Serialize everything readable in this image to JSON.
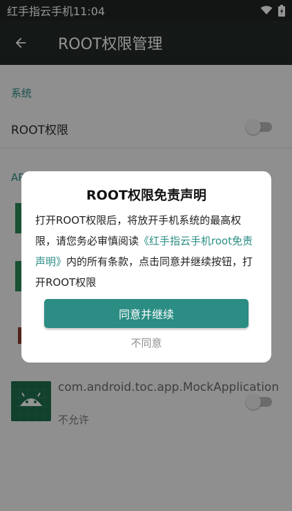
{
  "status_bar": {
    "time": "红手指云手机11:04",
    "wifi_icon": "wifi-icon",
    "battery_icon": "battery-icon"
  },
  "app_bar": {
    "title": "ROOT权限管理",
    "back_icon": "arrow-left-icon"
  },
  "system_section": {
    "label": "系统",
    "root_toggle": {
      "label": "ROOT权限",
      "enabled": false
    }
  },
  "apps_section": {
    "label": "APP 授权..."
  },
  "apps": [
    {
      "name": "com.android.toc.app.MockApplication",
      "status": "不允许",
      "enabled": false
    }
  ],
  "dialog": {
    "title": "ROOT权限免责声明",
    "body_prefix": "打开ROOT权限后，将放开手机系统的最高权限，请您务必审慎阅读",
    "body_link": "《红手指云手机root免责声明》",
    "body_suffix": "内的所有条款，点击同意并继续按钮，打开ROOT权限",
    "agree_label": "同意并继续",
    "disagree_label": "不同意"
  },
  "colors": {
    "accent": "#2b8d84",
    "appbar": "#242a28",
    "statusbar": "#1f2522"
  }
}
